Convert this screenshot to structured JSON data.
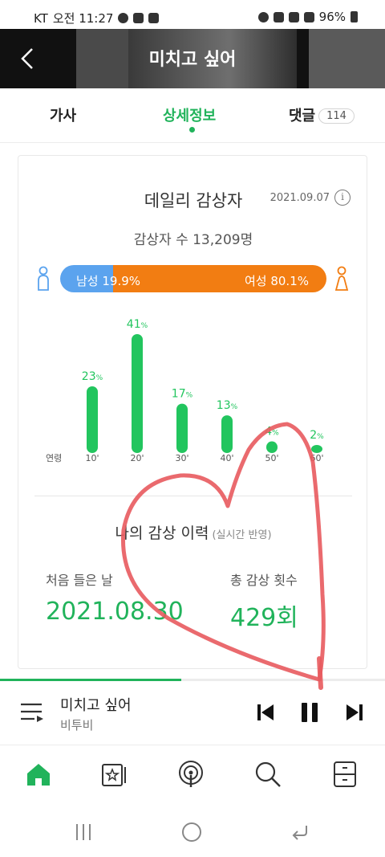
{
  "status_bar": {
    "carrier": "KT",
    "time": "오전 11:27",
    "battery": "96%"
  },
  "header": {
    "title": "미치고 싶어"
  },
  "tabs": [
    {
      "label": "가사"
    },
    {
      "label": "상세정보",
      "active": true
    },
    {
      "label": "댓글",
      "count": "114"
    }
  ],
  "card": {
    "title": "데일리 감상자",
    "date": "2021.09.07",
    "listeners": "감상자 수 13,209명",
    "gender": {
      "male_label": "남성 19.9%",
      "female_label": "여성 80.1%",
      "male_pct": 19.9,
      "female_pct": 80.1,
      "male_color": "#5ba3ee",
      "female_color": "#f27d12"
    },
    "history": {
      "title": "나의 감상 이력",
      "subtitle": "(실시간 반영)",
      "first_label": "처음 들은 날",
      "first_value": "2021.08.30",
      "total_label": "총 감상 횟수",
      "total_value": "429회"
    }
  },
  "chart_data": {
    "type": "bar",
    "xlabel": "연령",
    "categories": [
      "10'",
      "20'",
      "30'",
      "40'",
      "50'",
      "60'"
    ],
    "values": [
      23,
      41,
      17,
      13,
      4,
      2
    ],
    "unit": "%",
    "bar_color": "#22c55e",
    "ylim": [
      0,
      41
    ]
  },
  "player": {
    "song": "미치고 싶어",
    "artist": "비투비",
    "progress": 0.47
  },
  "accent_color": "#21b35b",
  "nav": [
    "home-icon",
    "music-card-icon",
    "podcast-icon",
    "search-icon",
    "storage-icon"
  ]
}
